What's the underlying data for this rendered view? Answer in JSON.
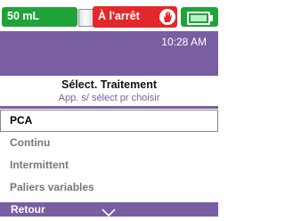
{
  "status": {
    "volume": "50 mL",
    "state": "À l'arrêt",
    "icons": {
      "volume_indicator": "syringe-level-icon",
      "hand": "hand-stop-icon",
      "battery": "battery-icon"
    },
    "colors": {
      "green": "#1fa33a",
      "red": "#e2282a",
      "purple": "#7a5ea2"
    }
  },
  "header": {
    "time": "10:28 AM"
  },
  "screen": {
    "title": "Sélect. Traitement",
    "subtitle": "App. s/ sélect pr choisir"
  },
  "options": [
    {
      "label": "PCA",
      "selected": true
    },
    {
      "label": "Continu",
      "selected": false
    },
    {
      "label": "Intermittent",
      "selected": false
    },
    {
      "label": "Paliers variables",
      "selected": false
    }
  ],
  "footer": {
    "back": "Retour",
    "scroll_icon": "chevron-down-icon"
  }
}
